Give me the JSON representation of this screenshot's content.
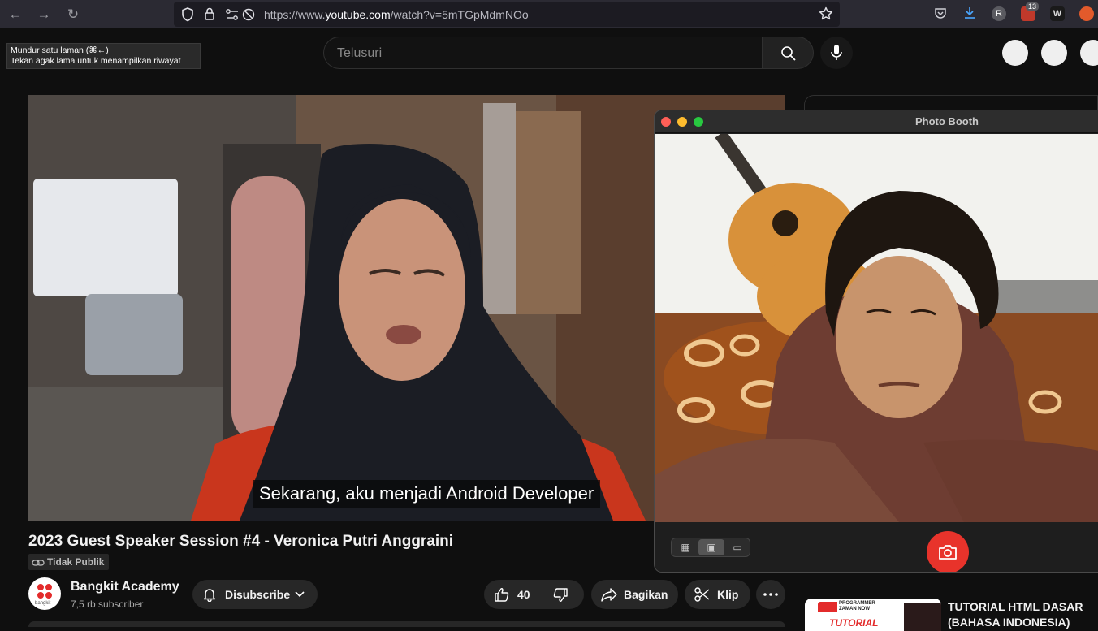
{
  "browser": {
    "url_prefix": "https://www.",
    "url_domain": "youtube.com",
    "url_path": "/watch?v=5mTGpMdmNOo",
    "extension_badge": "13",
    "extension_r": "R",
    "extension_w": "W"
  },
  "tooltip": {
    "line1": "Mundur satu laman (⌘←)",
    "line2": "Tekan agak lama untuk menampilkan riwayat"
  },
  "youtube": {
    "search_placeholder": "Telusuri",
    "subtitle": "Sekarang, aku menjadi Android Developer",
    "video_title": "2023 Guest Speaker Session #4 - Veronica Putri Anggraini",
    "privacy": "Tidak Publik",
    "channel_name": "Bangkit Academy",
    "channel_subs": "7,5 rb subscriber",
    "channel_avatar_text": "bangkit",
    "subscribe_label": "Disubscribe",
    "likes": "40",
    "share_label": "Bagikan",
    "clip_label": "Klip",
    "reco_title": "TUTORIAL HTML DASAR (BAHASA INDONESIA)",
    "reco_thumb_top": "PROGRAMMER ZAMAN NOW",
    "reco_thumb_text": "TUTORIAL"
  },
  "photobooth": {
    "title": "Photo Booth"
  },
  "colors": {
    "close": "#ff5f57",
    "minimize": "#febc2e",
    "zoom": "#28c840",
    "shutter": "#e8332b",
    "bangkit_red": "#e32b2b"
  }
}
